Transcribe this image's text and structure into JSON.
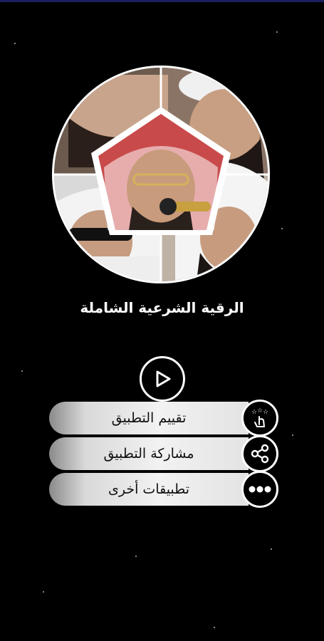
{
  "app": {
    "title": "الرقية الشرعية الشاملة"
  },
  "player": {
    "icon": "play-icon"
  },
  "menu": [
    {
      "label": "تقييم التطبيق",
      "icon": "rate-stars-icon"
    },
    {
      "label": "مشاركة التطبيق",
      "icon": "share-icon"
    },
    {
      "label": "تطبيقات أخرى",
      "icon": "more-dots-icon"
    }
  ],
  "colors": {
    "background": "#000000",
    "accent_bar": "#1b1f5e",
    "pill_light": "#f2f2f2",
    "pill_dark": "#8a8a8a"
  }
}
